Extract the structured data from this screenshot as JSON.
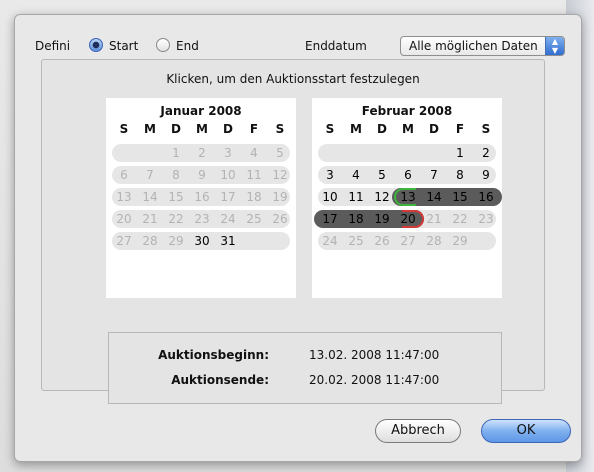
{
  "dialog": {
    "define_label": "Defini",
    "radio_start_label": "Start",
    "radio_end_label": "End",
    "enddate_label": "Enddatum",
    "enddate_value": "Alle möglichen Daten",
    "instruction": "Klicken, um den Auktionsstart festzulegen",
    "cancel_label": "Abbrech",
    "ok_label": "OK"
  },
  "calendar_left": {
    "title": "Januar 2008",
    "dow": [
      "S",
      "M",
      "D",
      "M",
      "D",
      "F",
      "S"
    ],
    "weeks": [
      [
        "",
        "",
        "1",
        "2",
        "3",
        "4",
        "5"
      ],
      [
        "6",
        "7",
        "8",
        "9",
        "10",
        "11",
        "12"
      ],
      [
        "13",
        "14",
        "15",
        "16",
        "17",
        "18",
        "19"
      ],
      [
        "20",
        "21",
        "22",
        "23",
        "24",
        "25",
        "26"
      ],
      [
        "27",
        "28",
        "29",
        "30",
        "31",
        "",
        ""
      ]
    ],
    "active_days": [
      "30",
      "31"
    ]
  },
  "calendar_right": {
    "title": "Februar 2008",
    "dow": [
      "S",
      "M",
      "D",
      "M",
      "D",
      "F",
      "S"
    ],
    "weeks": [
      [
        "",
        "",
        "",
        "",
        "",
        "1",
        "2"
      ],
      [
        "3",
        "4",
        "5",
        "6",
        "7",
        "8",
        "9"
      ],
      [
        "10",
        "11",
        "12",
        "13",
        "14",
        "15",
        "16"
      ],
      [
        "17",
        "18",
        "19",
        "20",
        "21",
        "22",
        "23"
      ],
      [
        "24",
        "25",
        "26",
        "27",
        "28",
        "29",
        ""
      ]
    ],
    "active_days": [
      "1",
      "2",
      "3",
      "4",
      "5",
      "6",
      "7",
      "8",
      "9",
      "10",
      "11",
      "12"
    ],
    "selected_days": [
      "13",
      "14",
      "15",
      "16",
      "17",
      "18",
      "19",
      "20"
    ]
  },
  "summary": {
    "begin_label": "Auktionsbeginn:",
    "begin_value": "13.02. 2008 11:47:00",
    "end_label": "Auktionsende:",
    "end_value": "20.02. 2008 11:47:00"
  }
}
